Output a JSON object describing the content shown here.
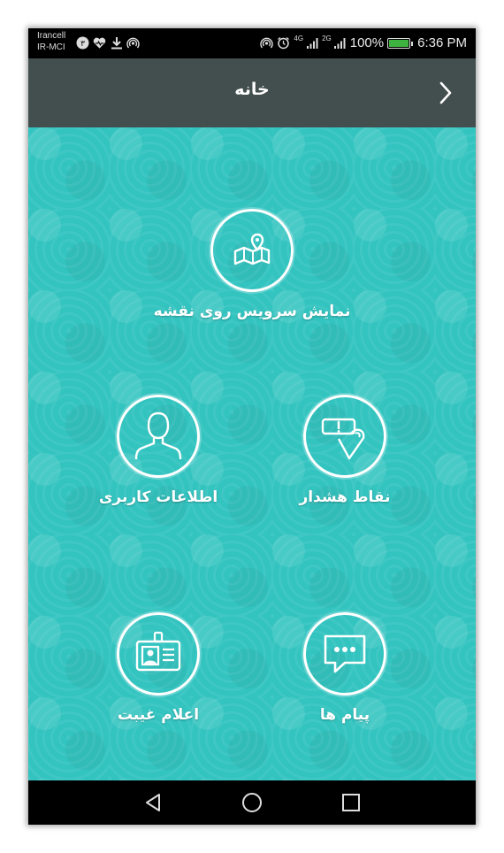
{
  "statusbar": {
    "carrier_line1": "Irancell",
    "carrier_line2": "IR-MCI",
    "notif_badge": "۳",
    "net_label_1": "4G",
    "net_label_2": "2G",
    "battery_percent": "100%",
    "battery_level": 1.0,
    "time": "6:36 PM"
  },
  "header": {
    "title": "خانه",
    "back_icon": "chevron-right-icon"
  },
  "menu": {
    "map_label": "نمایش سرویس روی نقشه",
    "user_info_label": "اطلاعات کاربری",
    "alert_points_label": "نقاط هشدار",
    "absence_label": "اعلام غیبت",
    "messages_label": "پیام ها"
  },
  "navbar": {
    "back": "back-triangle-icon",
    "home": "home-circle-icon",
    "recents": "recents-square-icon"
  },
  "colors": {
    "background": "#33c4c0",
    "header": "#434f4e",
    "icon_stroke": "#ffffff",
    "battery": "#3fb33f"
  }
}
